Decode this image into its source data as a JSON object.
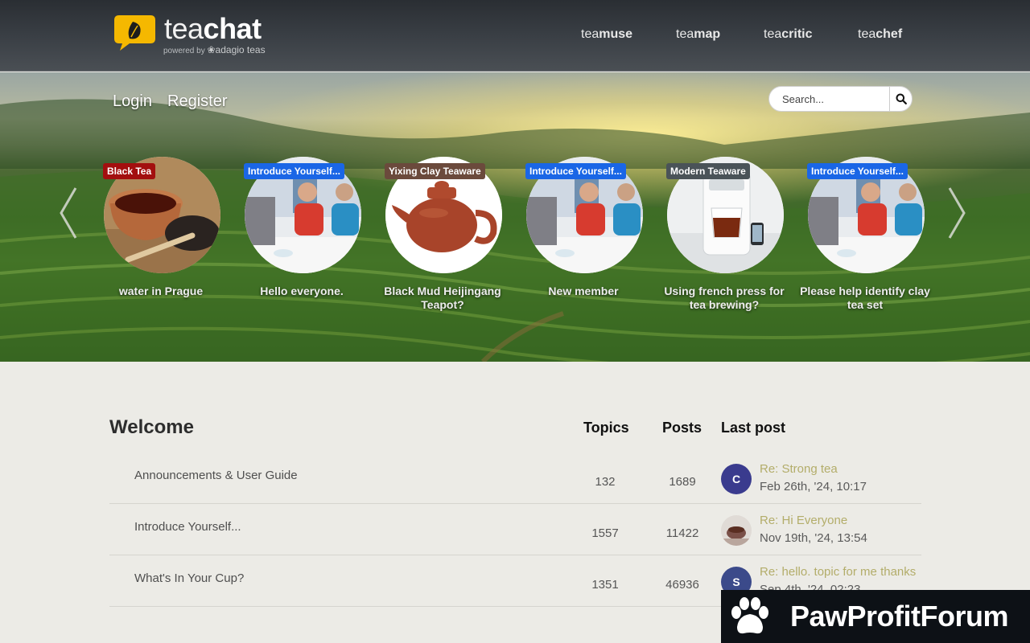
{
  "header": {
    "logo": {
      "word_light": "tea",
      "word_bold": "chat",
      "powered_by": "powered by",
      "partner": "adagio teas"
    },
    "nav": [
      {
        "light": "tea",
        "bold": "muse"
      },
      {
        "light": "tea",
        "bold": "map"
      },
      {
        "light": "tea",
        "bold": "critic"
      },
      {
        "light": "tea",
        "bold": "chef"
      }
    ]
  },
  "auth": {
    "login": "Login",
    "register": "Register"
  },
  "search": {
    "placeholder": "Search..."
  },
  "carousel": {
    "items": [
      {
        "tag": "Black Tea",
        "tag_color": "#a30f0f",
        "title": "water in Prague"
      },
      {
        "tag": "Introduce Yourself...",
        "tag_color": "#1a66e6",
        "title": "Hello everyone."
      },
      {
        "tag": "Yixing Clay Teaware",
        "tag_color": "#6b4a3c",
        "title": "Black Mud Heijingang Teapot?"
      },
      {
        "tag": "Introduce Yourself...",
        "tag_color": "#1a66e6",
        "title": "New member"
      },
      {
        "tag": "Modern Teaware",
        "tag_color": "#4a5358",
        "title": "Using french press for tea brewing?"
      },
      {
        "tag": "Introduce Yourself...",
        "tag_color": "#1a66e6",
        "title": "Please help identify clay tea set"
      }
    ]
  },
  "forum": {
    "section_title": "Welcome",
    "columns": {
      "topics": "Topics",
      "posts": "Posts",
      "last_post": "Last post"
    },
    "rows": [
      {
        "name": "Announcements & User Guide",
        "topics": "132",
        "posts": "1689",
        "avatar_letter": "C",
        "avatar_color": "#3a3b8e",
        "last_title": "Re: Strong tea",
        "last_date": "Feb 26th, '24, 10:17"
      },
      {
        "name": "Introduce Yourself...",
        "topics": "1557",
        "posts": "11422",
        "avatar_letter": "",
        "avatar_color": "#8a6b66",
        "last_title": "Re: Hi Everyone",
        "last_date": "Nov 19th, '24, 13:54"
      },
      {
        "name": "What's In Your Cup?",
        "topics": "1351",
        "posts": "46936",
        "avatar_letter": "S",
        "avatar_color": "#3b4a8a",
        "last_title": "Re: hello. topic for me thanks",
        "last_date": "Sep 4th, '24, 02:23"
      }
    ]
  },
  "watermark": {
    "text": "PawProfitForum"
  },
  "colors": {
    "last_post_link": "#b3ad6a",
    "logo_yellow": "#f5b800"
  }
}
